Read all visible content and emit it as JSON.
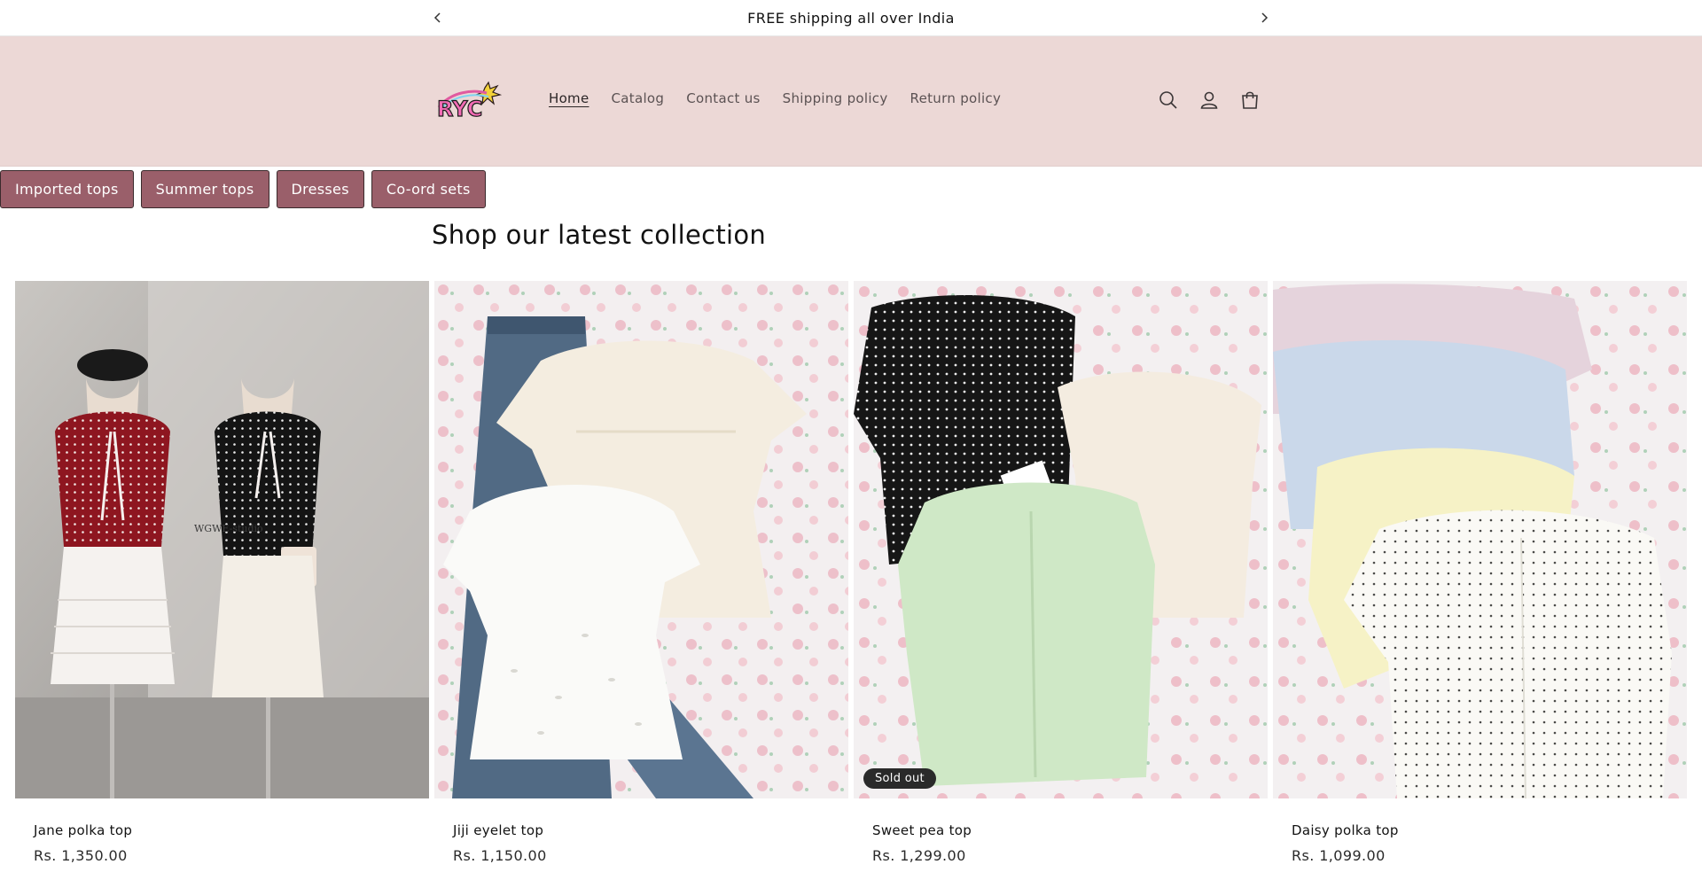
{
  "announcement": {
    "text": "FREE shipping all over India",
    "prev_icon": "chevron-left-icon",
    "next_icon": "chevron-right-icon"
  },
  "header": {
    "logo_text": "RYC",
    "nav": [
      {
        "label": "Home",
        "active": true
      },
      {
        "label": "Catalog",
        "active": false
      },
      {
        "label": "Contact us",
        "active": false
      },
      {
        "label": "Shipping policy",
        "active": false
      },
      {
        "label": "Return policy",
        "active": false
      }
    ],
    "icons": [
      "search-icon",
      "account-icon",
      "cart-icon"
    ]
  },
  "categories": [
    "Imported tops",
    "Summer tops",
    "Dresses",
    "Co-ord sets"
  ],
  "section_title": "Shop our latest collection",
  "products": [
    {
      "name": "Jane polka top",
      "price": "Rs. 1,350.00",
      "badge": "",
      "photo_text": "WGWE-studio"
    },
    {
      "name": "Jiji eyelet top",
      "price": "Rs. 1,150.00",
      "badge": ""
    },
    {
      "name": "Sweet pea top",
      "price": "Rs. 1,299.00",
      "badge": "Sold out"
    },
    {
      "name": "Daisy polka top",
      "price": "Rs. 1,099.00",
      "badge": ""
    }
  ],
  "colors": {
    "header_bg": "#ecd8d6",
    "category_button_bg": "#9a5f6a",
    "badge_bg": "#2a2a2a"
  }
}
